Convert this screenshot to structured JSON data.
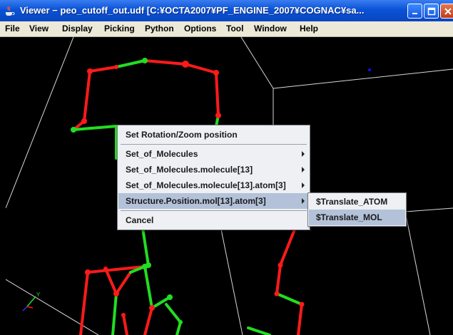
{
  "window": {
    "title": "Viewer − peo_cutoff_out.udf [C:¥OCTA2007¥PF_ENGINE_2007¥COGNAC¥sa..."
  },
  "menubar": {
    "items": [
      "File",
      "View",
      "Display",
      "Picking",
      "Python",
      "Options",
      "Tool",
      "Window",
      "Help"
    ]
  },
  "context_menu": {
    "items": [
      "Set Rotation/Zoom position",
      "Set_of_Molecules",
      "Set_of_Molecules.molecule[13]",
      "Set_of_Molecules.molecule[13].atom[3]",
      "Structure.Position.mol[13].atom[3]",
      "Cancel"
    ],
    "highlighted_index": 4
  },
  "submenu": {
    "items": [
      "$Translate_ATOM",
      "$Translate_MOL"
    ],
    "highlighted_index": 1
  },
  "axes": {
    "y_label": "Y"
  },
  "colors": {
    "bond_red": "#ff1a1a",
    "bond_green": "#22dd22",
    "box_lines": "#d8d8d8",
    "marker_blue": "#1010ff"
  }
}
